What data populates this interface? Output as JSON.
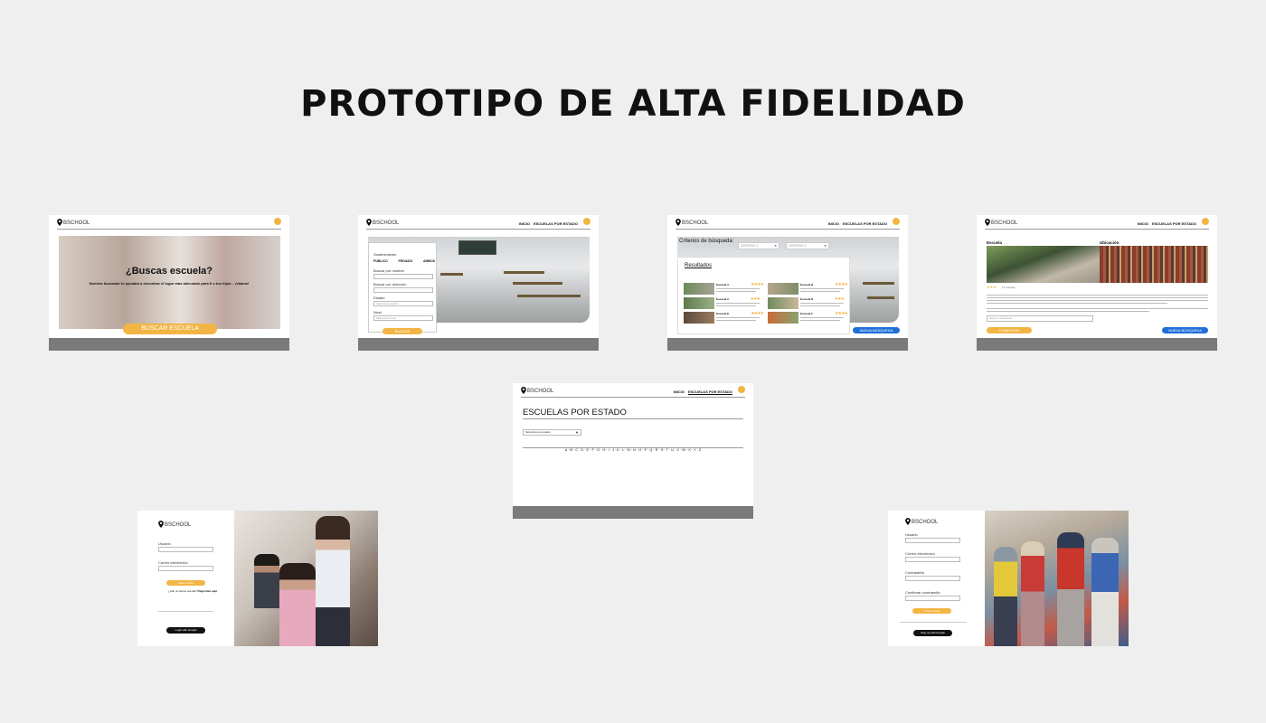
{
  "page_title": "PROTOTIPO DE ALTA FIDELIDAD",
  "brand": {
    "logo_text": "BSCHOOL",
    "accent_color": "#f2b544",
    "blue_color": "#1f6fd8",
    "footer_color": "#7a7a7a"
  },
  "nav": {
    "inicio": "INICIO",
    "escuelas_por_estado": "ESCUELAS POR ESTADO"
  },
  "screen1": {
    "headline": "¿Buscas escuela?",
    "subtitle": "Nuestro buscador te ayudará a encontrar el lugar más adecuado para ti o tus hijos... ¡Vamos!",
    "cta": "BUSCAR ESCUELA"
  },
  "screen2": {
    "sostenimiento_label": "Sostenimiento",
    "options": [
      "PÚBLICO",
      "PRIVADO",
      "AMBOS"
    ],
    "nombre_label": "Buscar por nombre",
    "direccion_label": "Buscar por dirección",
    "estado_label": "Estado",
    "estado_placeholder": "Selecciona estado",
    "nivel_label": "Nivel",
    "nivel_placeholder": "Selecciona nivel",
    "search_button": "BUSCAR"
  },
  "screen3": {
    "criteria_label": "Criterios de búsqueda:",
    "chips": [
      "CRITERIO 1",
      "CRITERIO 2"
    ],
    "results_title": "Resultados",
    "results": [
      {
        "name": "Escuela A",
        "stars": "★★★★"
      },
      {
        "name": "Escuela B",
        "stars": "★★★★"
      },
      {
        "name": "Escuela C",
        "stars": "★★★"
      },
      {
        "name": "Escuela D",
        "stars": "★★★"
      },
      {
        "name": "Escuela E",
        "stars": "★★★★"
      },
      {
        "name": "Escuela F",
        "stars": "★★★★"
      }
    ],
    "new_search_button": "NUEVA BÚSQUEDA"
  },
  "screen4": {
    "escuela_label": "Escuela",
    "ubicacion_label": "Ubicación",
    "rating": "★★★",
    "reviews": "12 reseñas",
    "comment_placeholder": "Deja tu comentario...",
    "comment_button": "COMENTAR",
    "new_search_button": "NUEVA BÚSQUEDA"
  },
  "screen5": {
    "heading": "ESCUELAS POR ESTADO",
    "select_placeholder": "Selecciona el estado",
    "alphabet": "A · B · C · D · E · F · G · H · I · J · K · L · M · N · O · P · Q · R · S · T · U · V · W · X · Y · Z"
  },
  "login": {
    "usuario_label": "Usuario",
    "correo_label": "Correo electrónico",
    "login_button": "Iniciar sesión",
    "register_prompt": "¿Aún no tienes cuenta?",
    "register_link": "Regístrate aquí",
    "google_button": "Login with Google"
  },
  "signup": {
    "usuario_label": "Usuario",
    "correo_label": "Correo electrónico",
    "password_label": "Contraseña",
    "confirm_label": "Confirmar contraseña",
    "signup_button": "Crear cuenta",
    "google_button": "Sing up with Google"
  }
}
